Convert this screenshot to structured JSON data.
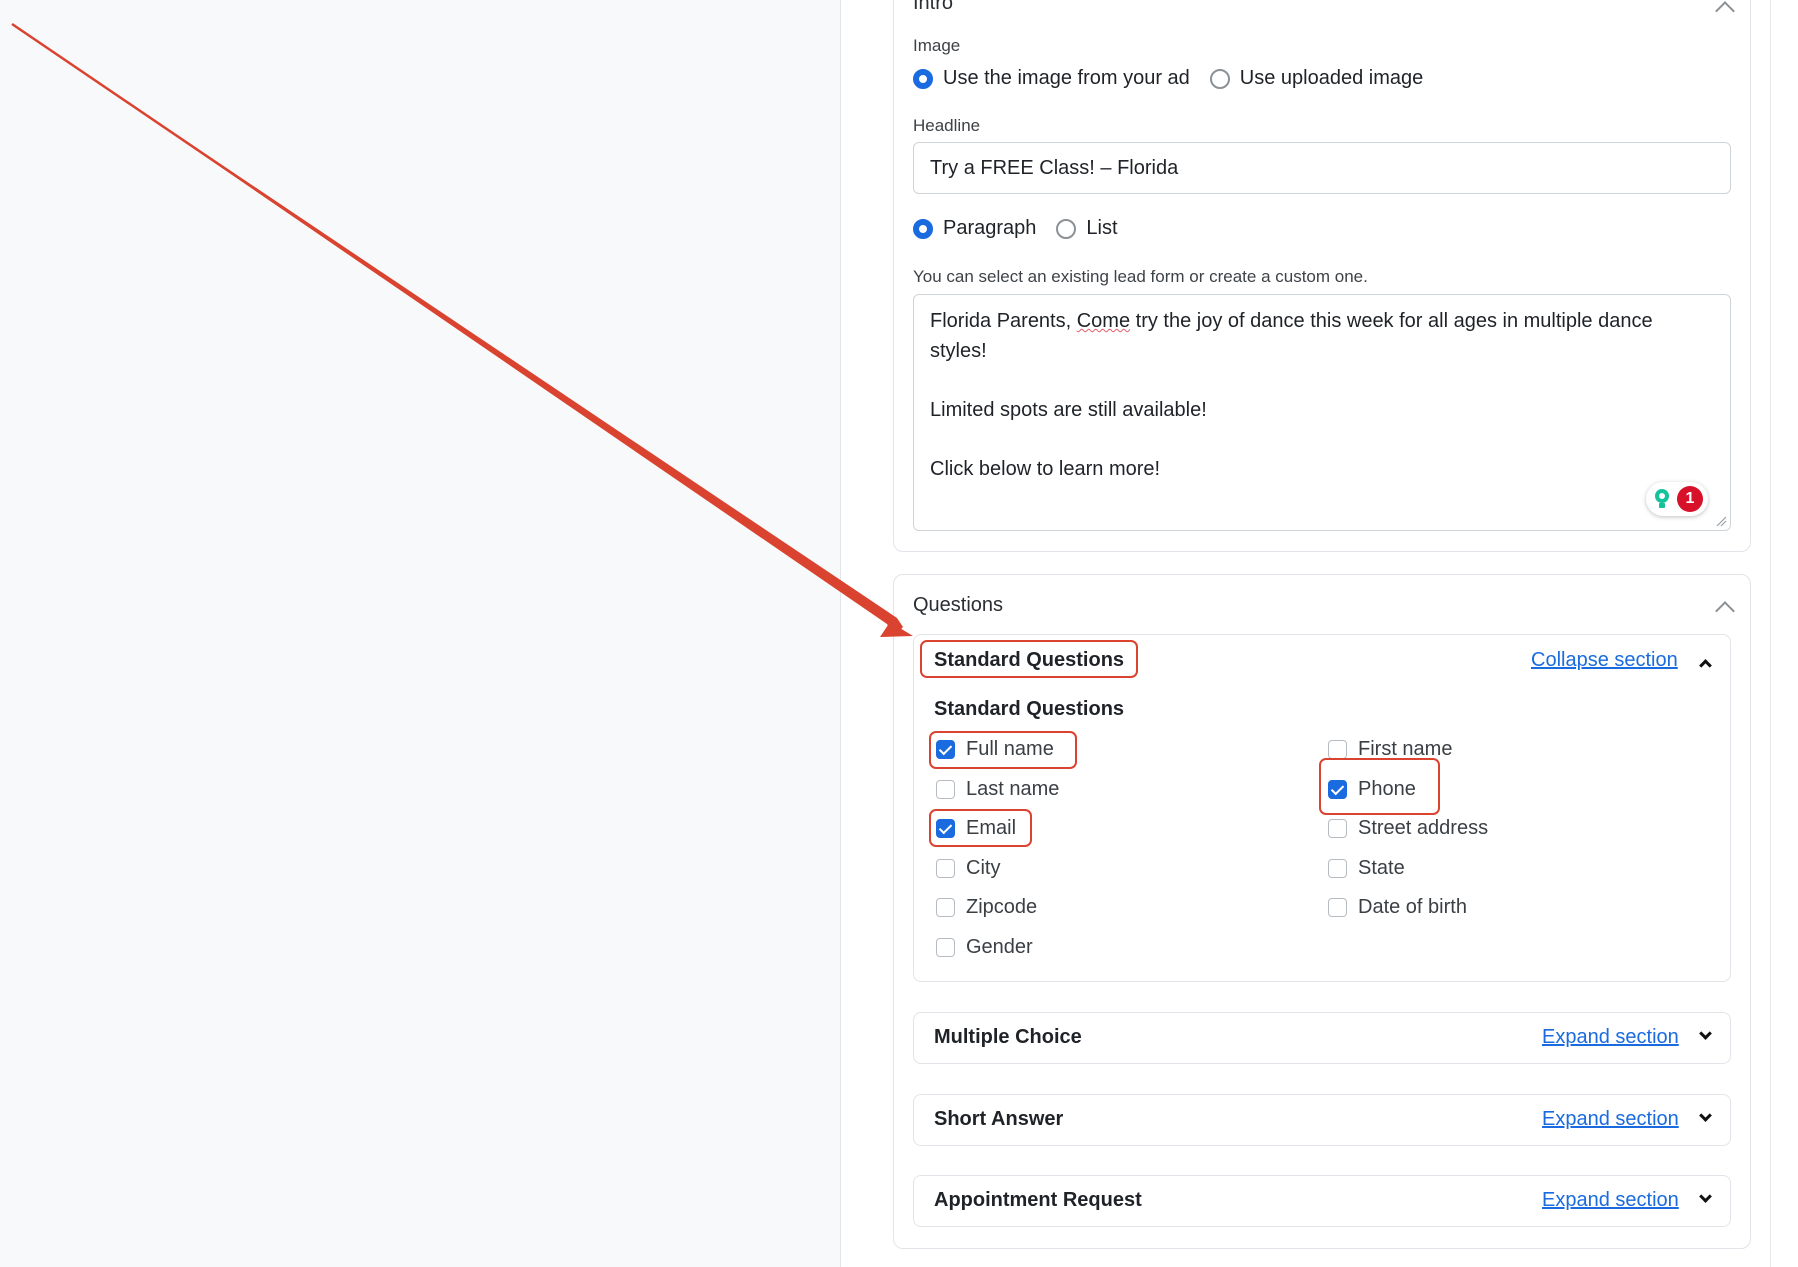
{
  "intro": {
    "section_title": "Intro",
    "image_label": "Image",
    "image_options": [
      "Use the image from your ad",
      "Use uploaded image"
    ],
    "image_selected": "Use the image from your ad",
    "headline_label": "Headline",
    "headline_value": "Try a FREE Class! – Florida",
    "format_options": [
      "Paragraph",
      "List"
    ],
    "format_selected": "Paragraph",
    "description_label": "You can select an existing lead form or create a custom one.",
    "description_lines": {
      "l1_pre": "Florida Parents, ",
      "l1_spell": "Come",
      "l1_post": " try the joy of dance this week for all ages in multiple dance styles!",
      "l2": "Limited spots are still available!",
      "l3": "Click below to learn more!"
    },
    "grammar_badge_count": "1"
  },
  "questions": {
    "section_title": "Questions",
    "standard": {
      "title": "Standard Questions",
      "toggle_link": "Collapse section",
      "group_label": "Standard Questions",
      "left_column": [
        {
          "label": "Full name",
          "checked": true
        },
        {
          "label": "Last name",
          "checked": false
        },
        {
          "label": "Email",
          "checked": true
        },
        {
          "label": "City",
          "checked": false
        },
        {
          "label": "Zipcode",
          "checked": false
        },
        {
          "label": "Gender",
          "checked": false
        }
      ],
      "right_column": [
        {
          "label": "First name",
          "checked": false
        },
        {
          "label": "Phone",
          "checked": true
        },
        {
          "label": "Street address",
          "checked": false
        },
        {
          "label": "State",
          "checked": false
        },
        {
          "label": "Date of birth",
          "checked": false
        }
      ]
    },
    "multiple_choice": {
      "title": "Multiple Choice",
      "toggle_link": "Expand section"
    },
    "short_answer": {
      "title": "Short Answer",
      "toggle_link": "Expand section"
    },
    "appointment_request": {
      "title": "Appointment Request",
      "toggle_link": "Expand section"
    }
  },
  "colors": {
    "accent": "#1a6be0",
    "annotation": "#d9432f",
    "badge": "#d8112b"
  }
}
